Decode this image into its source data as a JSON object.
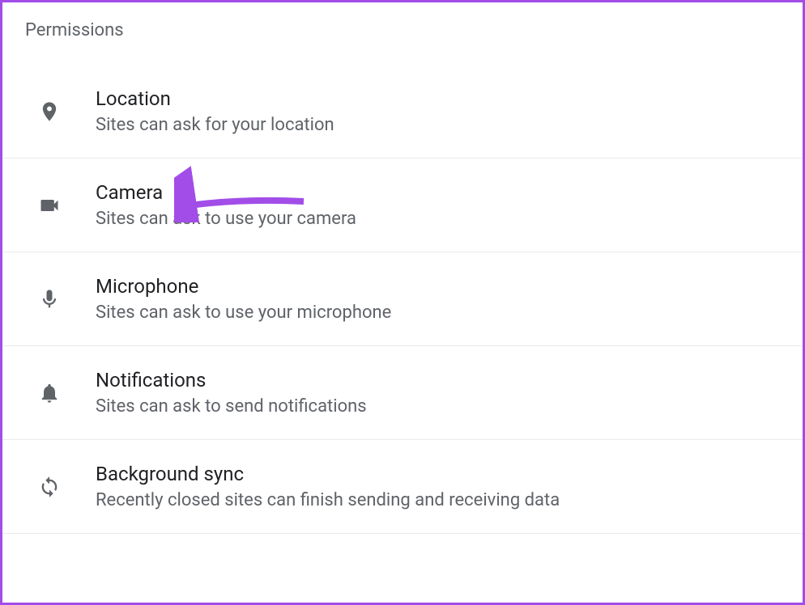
{
  "section": {
    "title": "Permissions"
  },
  "permissions": [
    {
      "title": "Location",
      "desc": "Sites can ask for your location"
    },
    {
      "title": "Camera",
      "desc": "Sites can ask to use your camera"
    },
    {
      "title": "Microphone",
      "desc": "Sites can ask to use your microphone"
    },
    {
      "title": "Notifications",
      "desc": "Sites can ask to send notifications"
    },
    {
      "title": "Background sync",
      "desc": "Recently closed sites can finish sending and receiving data"
    }
  ],
  "annotation": {
    "target": "Camera",
    "color": "#a24de8"
  }
}
